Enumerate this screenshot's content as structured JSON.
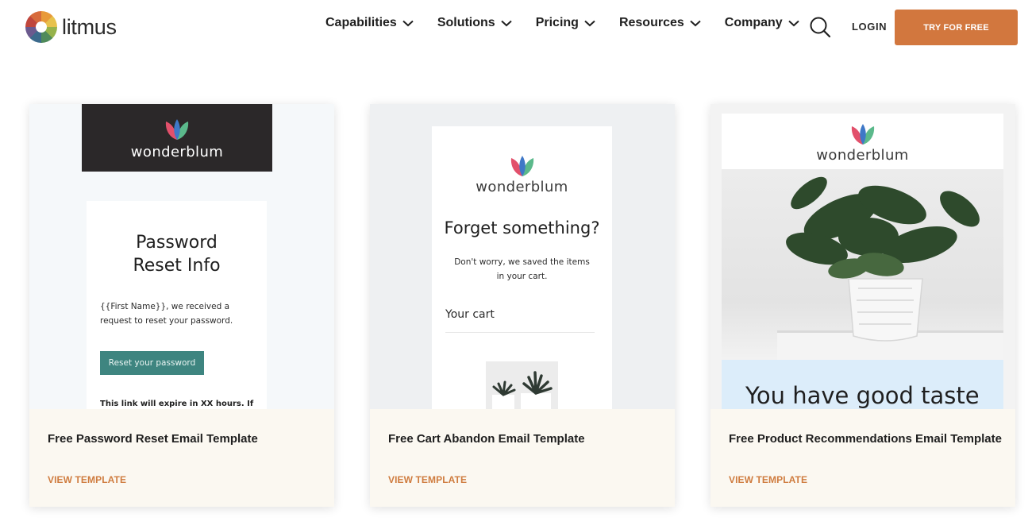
{
  "header": {
    "logo_text": "litmus",
    "nav": [
      {
        "label": "Capabilities"
      },
      {
        "label": "Solutions"
      },
      {
        "label": "Pricing"
      },
      {
        "label": "Resources"
      },
      {
        "label": "Company"
      }
    ],
    "login_label": "LOGIN",
    "cta_label": "TRY FOR FREE"
  },
  "cards": [
    {
      "title": "Free Password Reset Email Template",
      "link_label": "VIEW TEMPLATE",
      "preview": {
        "brand": "wonderblum",
        "heading_line1": "Password",
        "heading_line2": "Reset Info",
        "body": "{{First Name}}, we received a request to reset your password.",
        "button_label": "Reset your password",
        "footer_text": "This link will expire in XX hours. If"
      }
    },
    {
      "title": "Free Cart Abandon Email Template",
      "link_label": "VIEW TEMPLATE",
      "preview": {
        "brand": "wonderblum",
        "heading": "Forget something?",
        "body": "Don't worry, we saved the items in your cart.",
        "cart_label": "Your cart"
      }
    },
    {
      "title": "Free Product Recommendations Email Template",
      "link_label": "VIEW TEMPLATE",
      "preview": {
        "brand": "wonderblum",
        "heading": "You have good taste"
      }
    }
  ],
  "colors": {
    "accent": "#d2773e",
    "link": "#cf7c3f",
    "card_footer_bg": "#fbf8f1",
    "reset_button": "#3e8580"
  }
}
